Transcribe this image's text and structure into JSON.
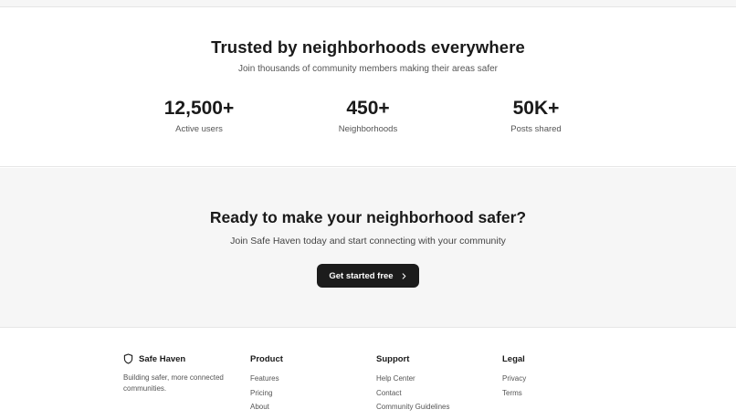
{
  "trust": {
    "title": "Trusted by neighborhoods everywhere",
    "subtitle": "Join thousands of community members making their areas safer",
    "stats": [
      {
        "value": "12,500+",
        "label": "Active users"
      },
      {
        "value": "450+",
        "label": "Neighborhoods"
      },
      {
        "value": "50K+",
        "label": "Posts shared"
      }
    ]
  },
  "cta": {
    "title": "Ready to make your neighborhood safer?",
    "subtitle": "Join Safe Haven today and start connecting with your community",
    "button_label": "Get started free"
  },
  "footer": {
    "brand_name": "Safe Haven",
    "brand_description": "Building safer, more connected communities.",
    "columns": [
      {
        "title": "Product",
        "links": [
          "Features",
          "Pricing",
          "About"
        ]
      },
      {
        "title": "Support",
        "links": [
          "Help Center",
          "Contact",
          "Community Guidelines"
        ]
      },
      {
        "title": "Legal",
        "links": [
          "Privacy",
          "Terms"
        ]
      }
    ]
  },
  "icons": {
    "brand": "shield-icon",
    "cta_arrow": "chevron-right-icon"
  },
  "colors": {
    "button_bg": "#1c1c1c",
    "section_alt_bg": "#f6f6f6"
  }
}
